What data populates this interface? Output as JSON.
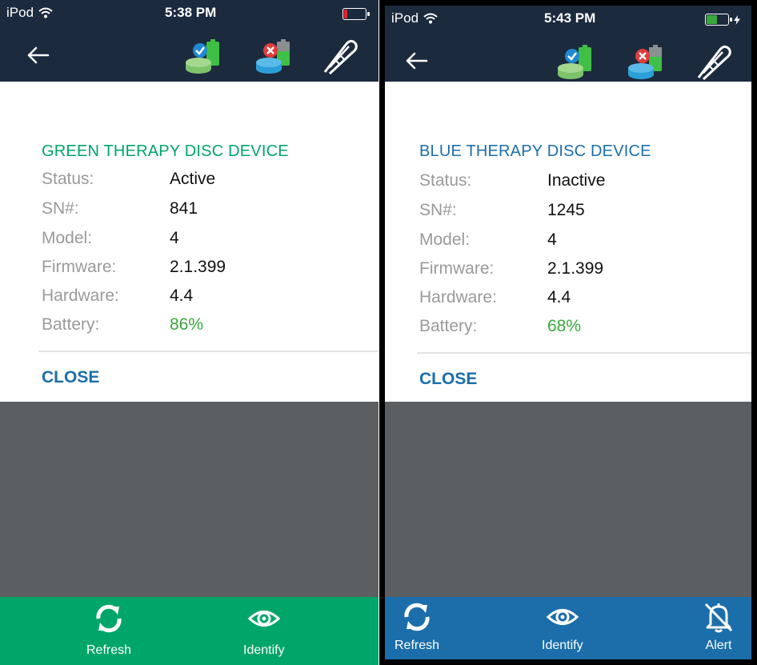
{
  "colors": {
    "nav_bg": "#1c2a3e",
    "green_accent": "#00a56a",
    "blue_accent": "#1b6eaa",
    "battery_ok": "#38a83c",
    "battery_low": "#e5232b",
    "overlay": "#5c5f61"
  },
  "left": {
    "status_bar": {
      "carrier": "iPod",
      "time": "5:38 PM",
      "battery_icon": "battery-low-icon",
      "battery_level": 0.15
    },
    "nav": {
      "back_icon": "back-arrow-icon",
      "icons": [
        "green-disc-battery-check-icon",
        "blue-disc-battery-x-icon",
        "tweezers-icon"
      ]
    },
    "device": {
      "title": "GREEN THERAPY DISC DEVICE",
      "fields": [
        {
          "label": "Status:",
          "value": "Active"
        },
        {
          "label": "SN#:",
          "value": "841"
        },
        {
          "label": "Model:",
          "value": "4"
        },
        {
          "label": "Firmware:",
          "value": "2.1.399"
        },
        {
          "label": "Hardware:",
          "value": "4.4"
        },
        {
          "label": "Battery:",
          "value": "86%"
        }
      ],
      "close_label": "CLOSE"
    },
    "toolbar": {
      "items": [
        {
          "label": "Refresh",
          "icon": "refresh-icon"
        },
        {
          "label": "Identify",
          "icon": "eye-icon"
        }
      ]
    }
  },
  "right": {
    "status_bar": {
      "carrier": "iPod",
      "time": "5:43 PM",
      "battery_icon": "battery-charging-icon",
      "battery_level": 0.5
    },
    "nav": {
      "back_icon": "back-arrow-icon",
      "icons": [
        "green-disc-battery-check-icon",
        "blue-disc-battery-x-icon",
        "tweezers-icon"
      ]
    },
    "device": {
      "title": "BLUE THERAPY DISC DEVICE",
      "fields": [
        {
          "label": "Status:",
          "value": "Inactive"
        },
        {
          "label": "SN#:",
          "value": "1245"
        },
        {
          "label": "Model:",
          "value": "4"
        },
        {
          "label": "Firmware:",
          "value": "2.1.399"
        },
        {
          "label": "Hardware:",
          "value": "4.4"
        },
        {
          "label": "Battery:",
          "value": "68%"
        }
      ],
      "close_label": "CLOSE"
    },
    "toolbar": {
      "items": [
        {
          "label": "Refresh",
          "icon": "refresh-icon"
        },
        {
          "label": "Identify",
          "icon": "eye-icon"
        },
        {
          "label": "Alert",
          "icon": "bell-off-icon"
        }
      ]
    }
  }
}
